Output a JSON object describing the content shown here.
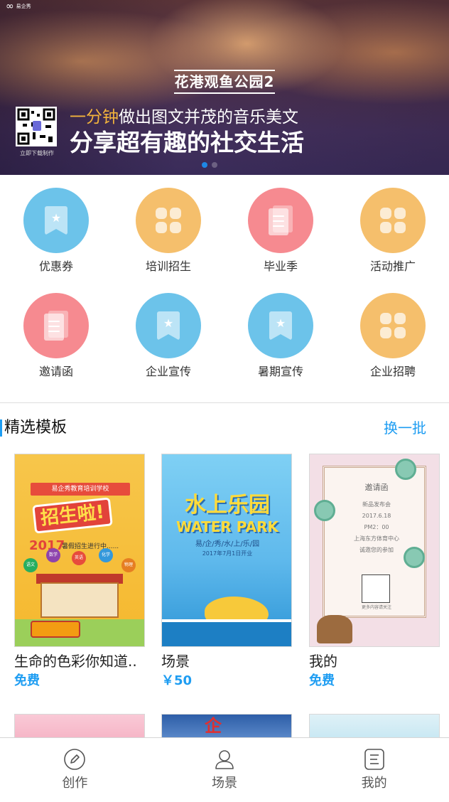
{
  "banner": {
    "brand_text": "易企秀",
    "title": "花港观鱼公园2",
    "headline_accent": "一分钟",
    "headline_rest": "做出图文并茂的音乐美文",
    "headline_main": "分享超有趣的社交生活",
    "qr_label": "立即下载制作",
    "active_slide": 1,
    "slide_count": 2
  },
  "categories": [
    {
      "label": "优惠券",
      "color": "blue",
      "icon": "bookmark-star-icon"
    },
    {
      "label": "培训招生",
      "color": "orange",
      "icon": "four-squares-icon"
    },
    {
      "label": "毕业季",
      "color": "pink",
      "icon": "document-icon"
    },
    {
      "label": "活动推广",
      "color": "orange",
      "icon": "four-squares-icon"
    },
    {
      "label": "邀请函",
      "color": "pink",
      "icon": "document-icon"
    },
    {
      "label": "企业宣传",
      "color": "blue",
      "icon": "bookmark-star-icon"
    },
    {
      "label": "暑期宣传",
      "color": "blue",
      "icon": "bookmark-star-icon"
    },
    {
      "label": "企业招聘",
      "color": "orange",
      "icon": "four-squares-icon"
    }
  ],
  "section": {
    "title": "精选模板",
    "refresh_label": "换一批"
  },
  "templates": [
    {
      "name": "生命的色彩你知道..",
      "price": "免费",
      "art": {
        "ribbon": "易企秀教育培训学校",
        "big": "招生啦!",
        "year": "2017",
        "year_text": "暑假招生进行中......",
        "bubbles": [
          "语文",
          "数学",
          "英语",
          "化学",
          "物理"
        ]
      }
    },
    {
      "name": "场景",
      "price": "￥50",
      "art": {
        "logo1": "水上乐园",
        "logo2": "WATER PARK",
        "sub": "易/企/秀/水/上/乐/园",
        "date": "2017年7月1日开业"
      }
    },
    {
      "name": "我的",
      "price": "免费",
      "art": {
        "t1": "邀请函",
        "t2": "新品发布会\n2017.6.18\nPM2：00\n上海东方体育中心\n诚邀您的参加",
        "qr_note": "更多内容请关注"
      }
    }
  ],
  "partial_templates": [
    {
      "glyph": ""
    },
    {
      "glyph": "企"
    },
    {
      "glyph": ""
    }
  ],
  "tabbar": [
    {
      "label": "创作",
      "icon": "pencil-circle-icon"
    },
    {
      "label": "场景",
      "icon": "person-icon"
    },
    {
      "label": "我的",
      "icon": "list-doc-icon"
    }
  ],
  "colors": {
    "accent": "#1e9df2",
    "blue_circle": "#6cc3ea",
    "orange_circle": "#f5bf6c",
    "pink_circle": "#f68a90",
    "banner_highlight": "#f2b33c"
  }
}
